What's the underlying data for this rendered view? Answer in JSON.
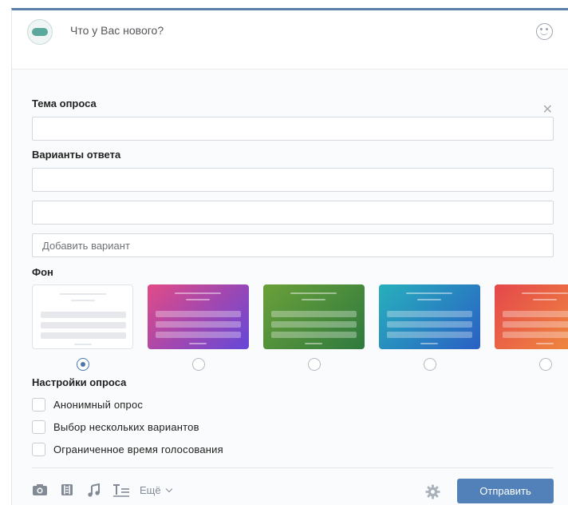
{
  "status": {
    "placeholder": "Что у Вас нового?"
  },
  "poll": {
    "topic_label": "Тема опроса",
    "topic_value": "",
    "answers_label": "Варианты ответа",
    "answers": [
      {
        "value": ""
      },
      {
        "value": ""
      }
    ],
    "add_option_placeholder": "Добавить вариант",
    "background_label": "Фон",
    "backgrounds": [
      {
        "name": "white",
        "selected": true,
        "colors": [
          "#ffffff",
          "#ffffff"
        ]
      },
      {
        "name": "pink-purple",
        "selected": false,
        "colors": [
          "#e24a86",
          "#6447d8"
        ]
      },
      {
        "name": "green",
        "selected": false,
        "colors": [
          "#6aa03a",
          "#2f7a3e"
        ]
      },
      {
        "name": "teal-blue",
        "selected": false,
        "colors": [
          "#27b0bc",
          "#2a5fc4"
        ]
      },
      {
        "name": "red-orange",
        "selected": false,
        "colors": [
          "#e5474b",
          "#f0933c"
        ]
      }
    ],
    "settings_label": "Настройки опроса",
    "options": [
      {
        "label": "Анонимный опрос",
        "checked": false
      },
      {
        "label": "Выбор нескольких вариантов",
        "checked": false
      },
      {
        "label": "Ограниченное время голосования",
        "checked": false
      }
    ]
  },
  "toolbar": {
    "icons": [
      "camera-icon",
      "video-icon",
      "music-icon",
      "text-format-icon"
    ],
    "more_label": "Ещё",
    "send_label": "Отправить"
  },
  "colors": {
    "accent": "#5181b8",
    "top_border": "#5b7fa6",
    "panel_bg": "#fafbfc"
  }
}
